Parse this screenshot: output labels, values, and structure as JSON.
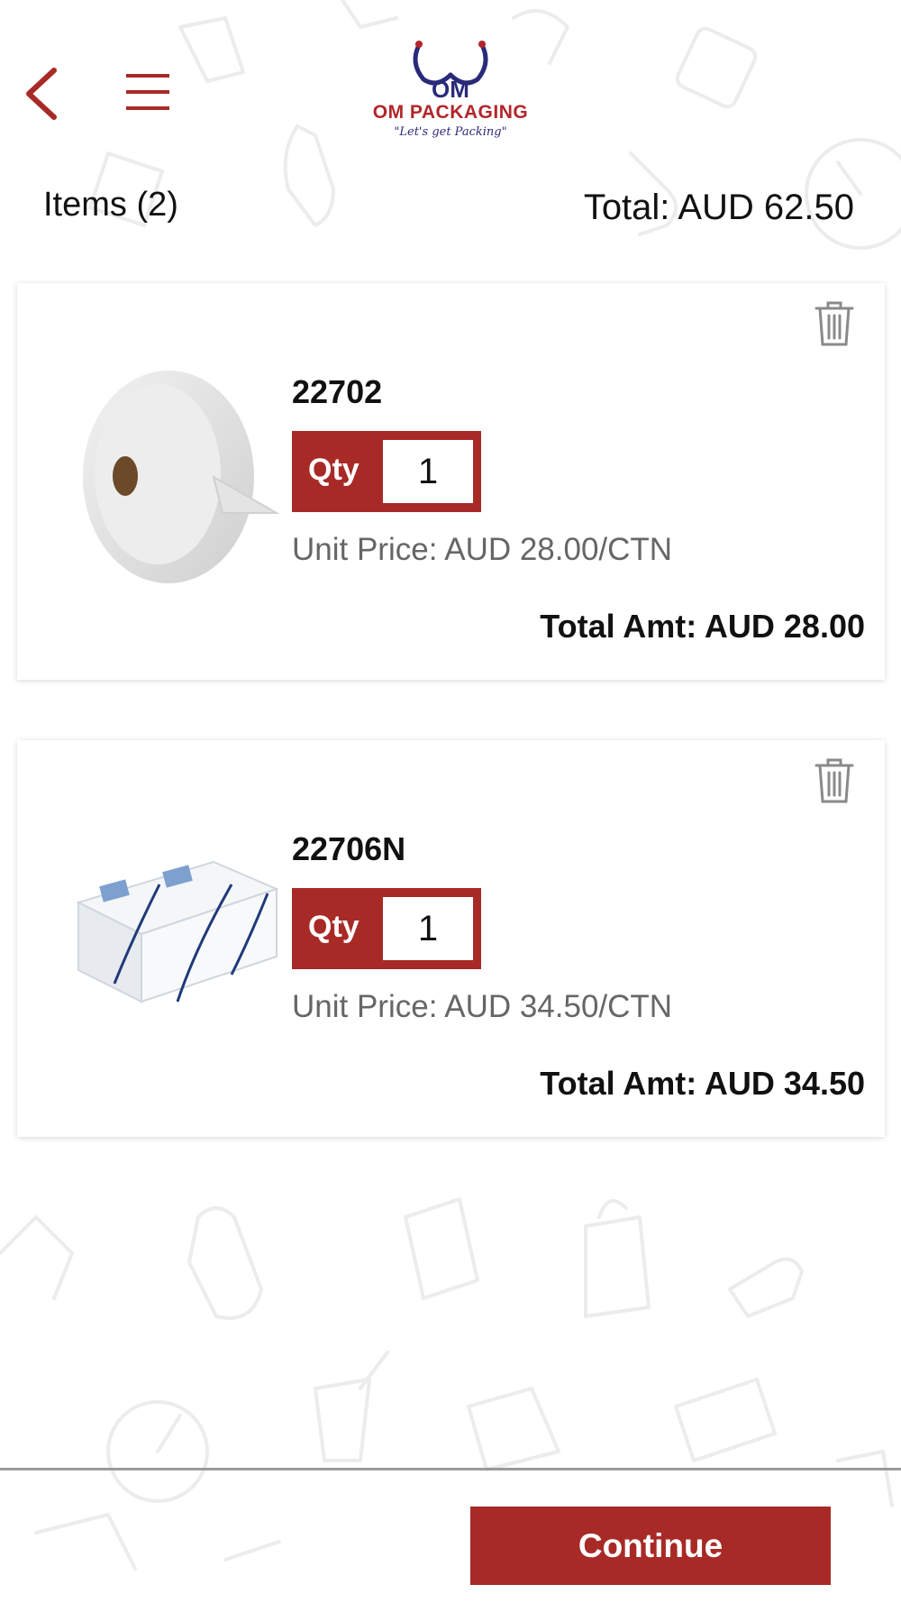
{
  "header": {
    "logo_title": "OM PACKAGING",
    "logo_tagline": "\"Let's get Packing\"",
    "logo_monogram": "OM",
    "back_icon": "chevron-left-icon",
    "menu_icon": "hamburger-menu-icon"
  },
  "summary": {
    "items_label": "Items (2)",
    "total_label": "Total: AUD 62.50"
  },
  "cart": {
    "items": [
      {
        "sku": "22702",
        "qty_label": "Qty",
        "qty_value": "1",
        "unit_price": "Unit Price: AUD 28.00/CTN",
        "total_amount": "Total Amt: AUD 28.00",
        "image_icon": "toilet-paper-jumbo-roll-image",
        "delete_icon": "trash-icon"
      },
      {
        "sku": "22706N",
        "qty_label": "Qty",
        "qty_value": "1",
        "unit_price": "Unit Price: AUD 34.50/CTN",
        "total_amount": "Total Amt: AUD 34.50",
        "image_icon": "folded-hand-towel-pack-image",
        "delete_icon": "trash-icon"
      }
    ]
  },
  "footer": {
    "continue_label": "Continue"
  },
  "colors": {
    "brand_red": "#a82a27",
    "logo_navy": "#2a2a7a",
    "text_dark": "#111111",
    "text_muted": "#666666",
    "pattern": "#ececec"
  }
}
